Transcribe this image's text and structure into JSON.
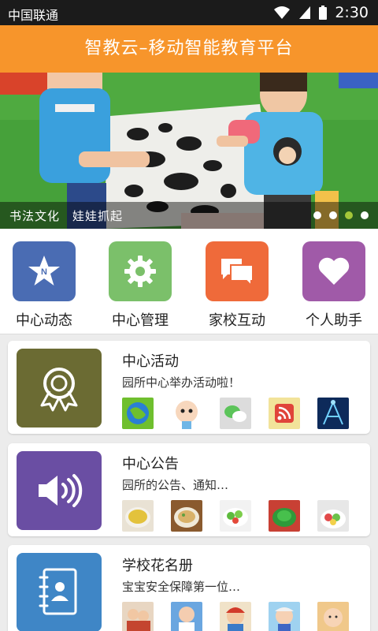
{
  "status_bar": {
    "carrier": "中国联通",
    "time": "2:30"
  },
  "header": {
    "title": "智教云–移动智能教育平台"
  },
  "banner": {
    "caption": "书法文化　娃娃抓起",
    "active_dot": 3,
    "dot_count": 4
  },
  "quick_menu": [
    {
      "label": "中心动态",
      "icon": "star-badge-icon",
      "color": "#4a6cb3"
    },
    {
      "label": "中心管理",
      "icon": "gear-icon",
      "color": "#7bc06a"
    },
    {
      "label": "家校互动",
      "icon": "chat-bubbles-icon",
      "color": "#ef6a3a"
    },
    {
      "label": "个人助手",
      "icon": "heart-icon",
      "color": "#a05aa8"
    }
  ],
  "cards": [
    {
      "title": "中心活动",
      "subtitle": "园所中心举办活动啦！",
      "icon": "award-ribbon-icon",
      "color": "#6b6b33"
    },
    {
      "title": "中心公告",
      "subtitle": "园所的公告、通知…",
      "icon": "speaker-icon",
      "color": "#6a4ea3"
    },
    {
      "title": "学校花名册",
      "subtitle": "宝宝安全保障第一位…",
      "icon": "contact-book-icon",
      "color": "#3f86c6"
    }
  ]
}
